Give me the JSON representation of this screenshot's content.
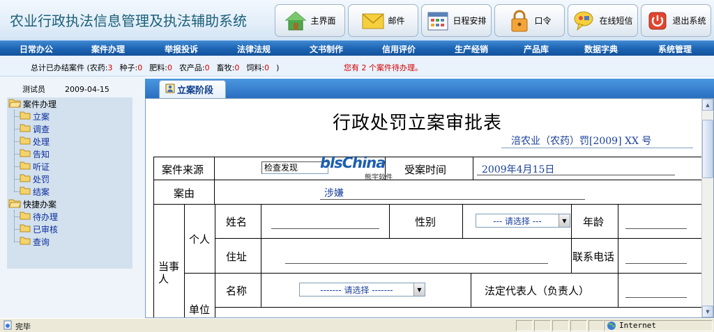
{
  "app": {
    "title": "农业行政执法信息管理及执法辅助系统"
  },
  "toolbar": [
    {
      "label": "主界面",
      "icon": "home-icon"
    },
    {
      "label": "邮件",
      "icon": "envelope-icon"
    },
    {
      "label": "日程安排",
      "icon": "calendar-icon"
    },
    {
      "label": "口令",
      "icon": "lock-icon"
    },
    {
      "label": "在线短信",
      "icon": "chat-icon"
    },
    {
      "label": "退出系统",
      "icon": "power-icon"
    }
  ],
  "menu": [
    "日常办公",
    "案件办理",
    "举报投诉",
    "法律法规",
    "文书制作",
    "信用评价",
    "生产经销",
    "产品库",
    "数据字典",
    "系统管理"
  ],
  "summary": {
    "prefix": "总计已办结案件 (农药:",
    "counts": [
      {
        "label": "",
        "value": "3"
      },
      {
        "label": "种子:",
        "value": "0"
      },
      {
        "label": "肥料:",
        "value": "0"
      },
      {
        "label": "农产品:",
        "value": "0"
      },
      {
        "label": "畜牧:",
        "value": "0"
      },
      {
        "label": "饲料:",
        "value": "0"
      }
    ],
    "suffix": ")",
    "pending": "您有 2 个案件待办理。"
  },
  "sidebar": {
    "user": "测试员",
    "date": "2009-04-15",
    "groups": [
      {
        "label": "案件办理",
        "items": [
          "立案",
          "调查",
          "处理",
          "告知",
          "听证",
          "处罚",
          "结案"
        ]
      },
      {
        "label": "快捷办案",
        "items": [
          "待办理",
          "已审核",
          "查询"
        ]
      }
    ]
  },
  "tab": {
    "label": "立案阶段"
  },
  "document": {
    "title": "行政处罚立案审批表",
    "number": "涪农业（农药）罚[2009] XX 号",
    "fields": {
      "source_label": "案件来源",
      "source_value": "检查发现",
      "accept_time_label": "受案时间",
      "accept_time_value": "2009年4月15日",
      "cause_label": "案由",
      "cause_value": "涉嫌",
      "party_label": "当事人",
      "individual_label": "个人",
      "unit_label": "单位",
      "name_label": "姓名",
      "gender_label": "性别",
      "gender_select": "--- 请选择 ---",
      "age_label": "年龄",
      "address_label": "住址",
      "phone_label": "联系电话",
      "unit_name_label": "名称",
      "unit_name_select": "------- 请选择 -------",
      "legal_rep_label": "法定代表人（负责人）"
    },
    "watermark": {
      "brand": "blsChina",
      "sub": "熊宇软件"
    }
  },
  "statusbar": {
    "text": "完毕",
    "zone": "Internet"
  },
  "colors": {
    "menu": "#1b63b2",
    "accent_red": "#d40000",
    "link_blue": "#0b2d9c",
    "title": "#1c5f78"
  }
}
